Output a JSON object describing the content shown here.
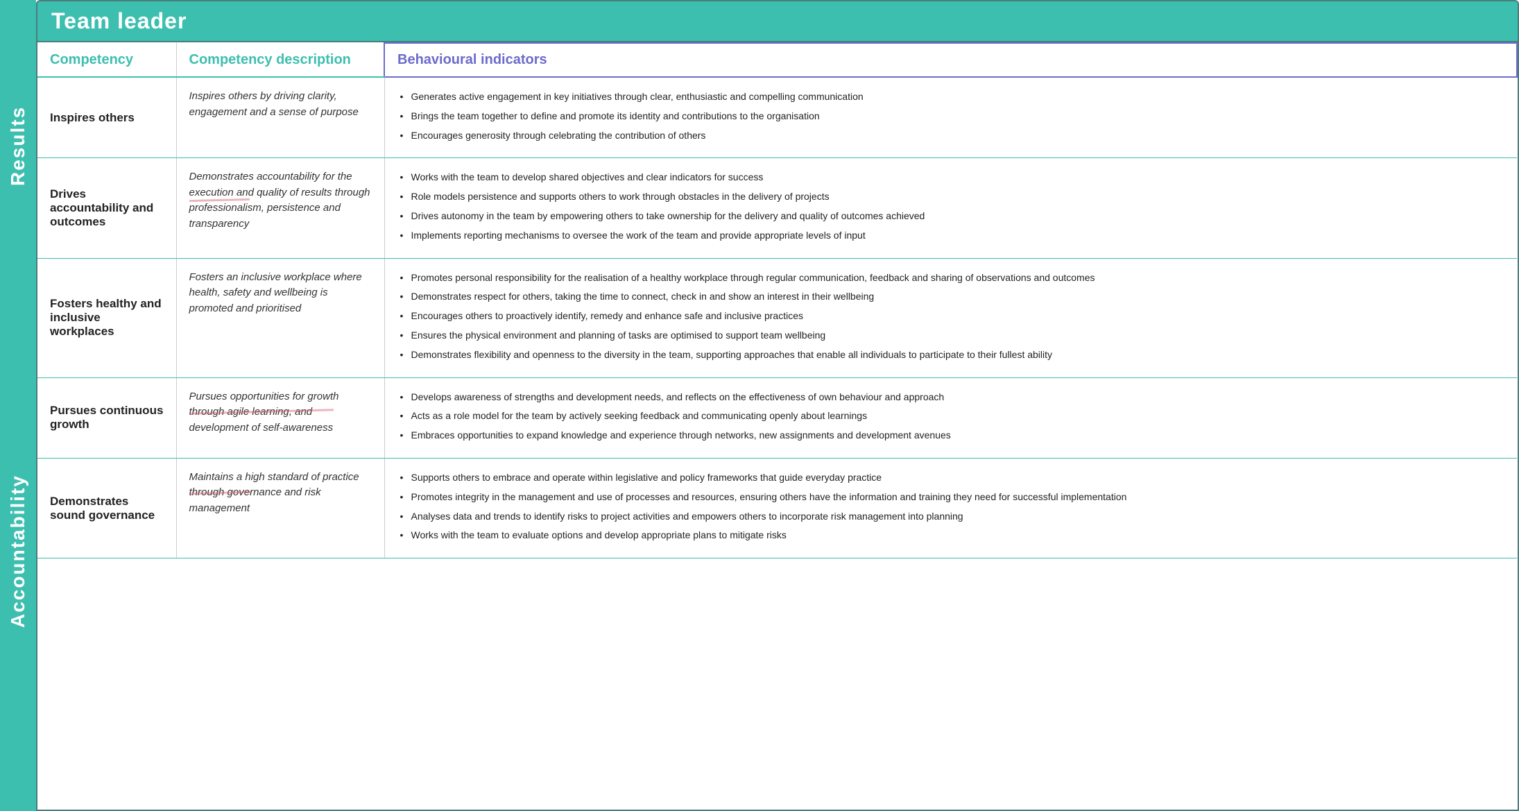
{
  "title": "Team leader",
  "colors": {
    "teal": "#3dbfb0",
    "purple": "#6b6bcc",
    "white": "#ffffff"
  },
  "side_labels": [
    {
      "id": "results",
      "text": "Results"
    },
    {
      "id": "accountability",
      "text": "Accountability"
    }
  ],
  "header": {
    "col1": "Competency",
    "col2": "Competency description",
    "col3": "Behavioural indicators"
  },
  "rows": [
    {
      "competency": "Inspires others",
      "description": "Inspires others by driving clarity, engagement and a sense of purpose",
      "indicators": [
        "Generates active engagement in key initiatives through clear, enthusiastic and compelling communication",
        "Brings the team together to define and promote its identity and contributions to the organisation",
        "Encourages generosity through celebrating the contribution of others"
      ],
      "has_strikethrough": false
    },
    {
      "competency": "Drives accountability and outcomes",
      "description": "Demonstrates accountability for the execution and quality of results through professionalism, persistence and transparency",
      "indicators": [
        "Works with the team to develop shared objectives and clear indicators for success",
        "Role models persistence and supports others to work through obstacles in the delivery of projects",
        "Drives autonomy in the team by empowering others to take ownership for the delivery and quality of outcomes achieved",
        "Implements reporting mechanisms to oversee the work of the team and provide appropriate levels of input"
      ],
      "has_strikethrough": true
    },
    {
      "competency": "Fosters healthy and inclusive workplaces",
      "description": "Fosters an inclusive workplace where health, safety and wellbeing is promoted and prioritised",
      "indicators": [
        "Promotes personal responsibility for the realisation of a healthy workplace through regular communication, feedback and sharing of observations and outcomes",
        "Demonstrates respect for others, taking the time to connect, check in and show an interest in their wellbeing",
        "Encourages others to proactively identify, remedy and enhance safe and inclusive practices",
        "Ensures the physical environment and planning of tasks are optimised to support team wellbeing",
        "Demonstrates flexibility and openness to the diversity in the team, supporting approaches that enable all individuals to participate to their fullest ability"
      ],
      "has_strikethrough": false
    },
    {
      "competency": "Pursues continuous growth",
      "description": "Pursues opportunities for growth through agile learning, and development of self-awareness",
      "indicators": [
        "Develops awareness of strengths and development needs, and reflects on the effectiveness of own behaviour and approach",
        "Acts as a role model for the team by actively seeking feedback and communicating openly about learnings",
        "Embraces opportunities to expand knowledge and experience through networks, new assignments and development avenues"
      ],
      "has_strikethrough": true
    },
    {
      "competency": "Demonstrates sound governance",
      "description": "Maintains a high standard of practice through governance and risk management",
      "indicators": [
        "Supports others to embrace and operate within legislative and policy frameworks that guide everyday practice",
        "Promotes integrity in the management and use of processes and resources, ensuring others have the information and training they need for successful implementation",
        "Analyses data and trends to identify risks to project activities and empowers others to incorporate risk management into planning",
        "Works with the team to evaluate options and develop appropriate plans to mitigate risks"
      ],
      "has_strikethrough": true
    }
  ]
}
